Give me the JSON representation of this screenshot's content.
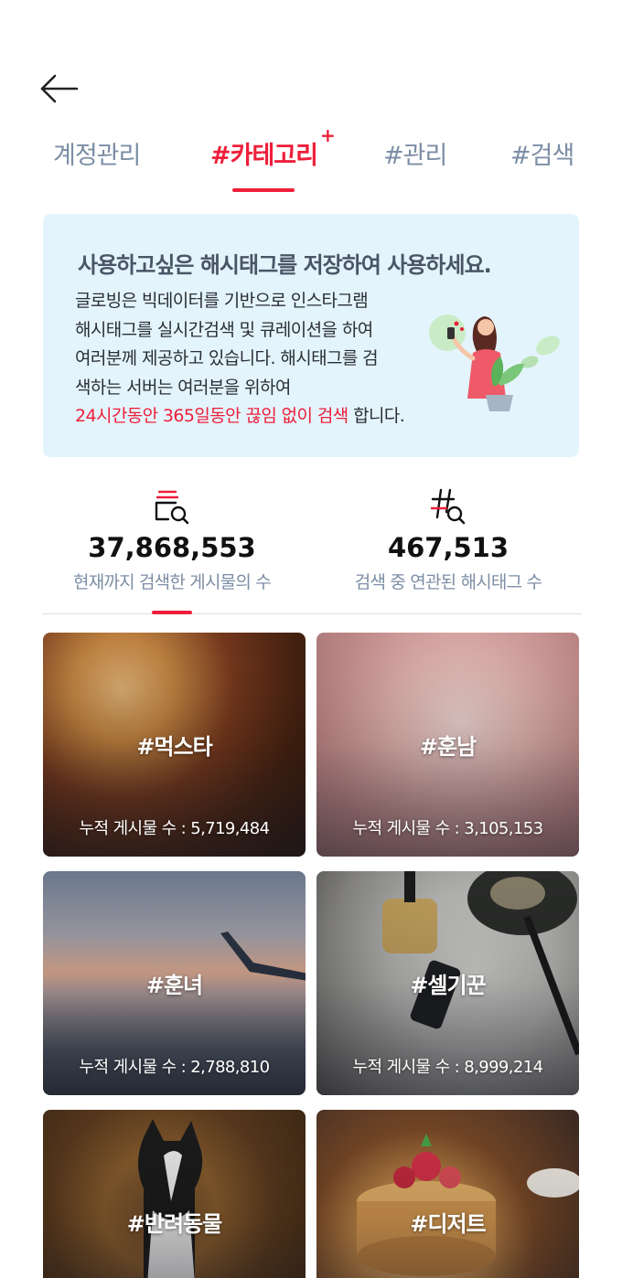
{
  "header": {
    "back_icon": "arrow-left-icon"
  },
  "tabs": [
    {
      "label": "계정관리",
      "active": false
    },
    {
      "label": "#카테고리",
      "active": true,
      "badge": "+"
    },
    {
      "label": "#관리",
      "active": false
    },
    {
      "label": "#검색",
      "active": false
    }
  ],
  "info": {
    "title": "사용하고싶은 해시태그를 저장하여 사용하세요.",
    "lines": [
      "글로빙은 빅데이터를 기반으로 인스타그램",
      "해시태그를 실시간검색 및 큐레이션을 하여",
      "여러분께 제공하고 있습니다. 해시태그를 검",
      "색하는 서버는 여러분을 위하여"
    ],
    "highlight": "24시간동안 365일동안 끊임 없이 검색",
    "suffix": " 합니다.",
    "illustration": "woman-with-phone-illustration"
  },
  "stats": [
    {
      "icon": "posts-search-icon",
      "value": "37,868,553",
      "label": "현재까지 검색한 게시물의 수"
    },
    {
      "icon": "hashtag-search-icon",
      "value": "467,513",
      "label": "검색 중 연관된 해시태그 수"
    }
  ],
  "categories": [
    {
      "tag": "#먹스타",
      "count": "누적 게시물 수 : 5,719,484",
      "image": "bbq-food-photo"
    },
    {
      "tag": "#훈남",
      "count": "누적 게시물 수 : 3,105,153",
      "image": "baby-feet-photo"
    },
    {
      "tag": "#훈녀",
      "count": "누적 게시물 수 : 2,788,810",
      "image": "airplane-sky-photo"
    },
    {
      "tag": "#셀기꾼",
      "count": "누적 게시물 수 : 8,999,214",
      "image": "cosmetics-oil-photo"
    },
    {
      "tag": "#반려동물",
      "count": "",
      "image": "dog-photo"
    },
    {
      "tag": "#디저트",
      "count": "",
      "image": "pancake-dessert-photo"
    }
  ],
  "colors": {
    "accent": "#ed1f3a",
    "tab_inactive": "#7c8ea5",
    "info_bg": "#e4f4fc"
  }
}
